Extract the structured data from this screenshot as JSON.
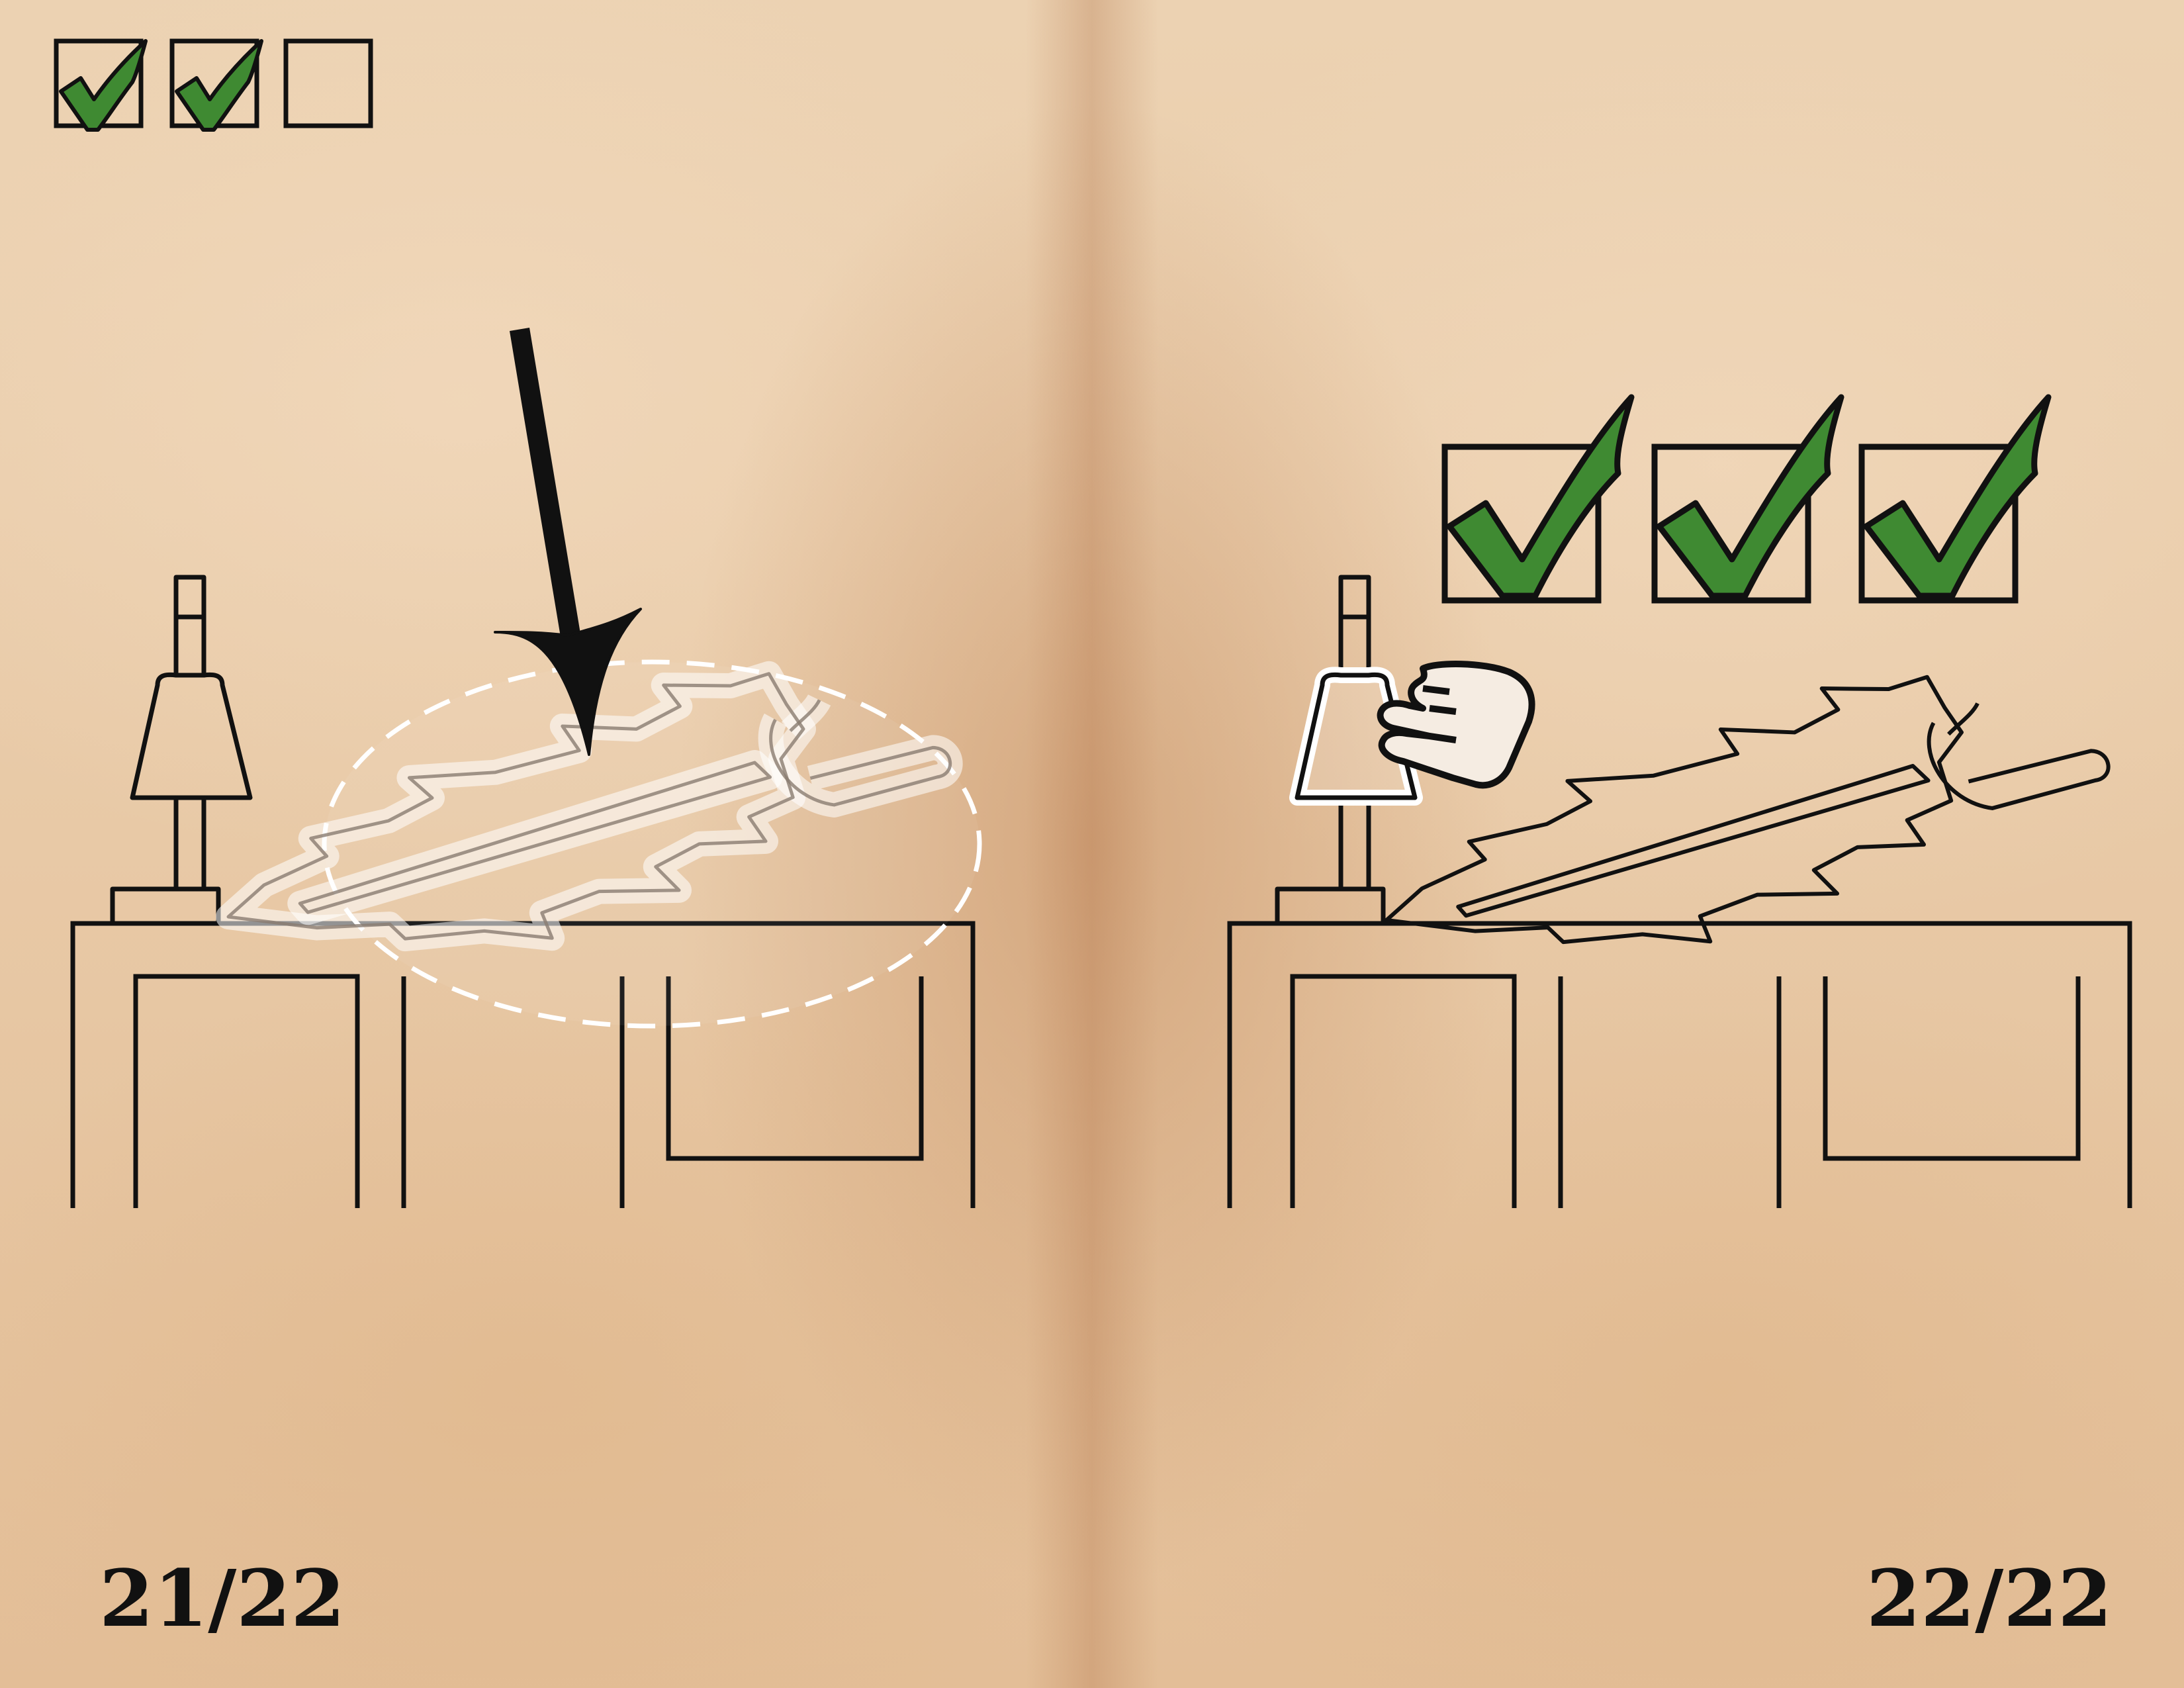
{
  "pages": {
    "left": {
      "page_number": "21/22",
      "progress": {
        "checked": 2,
        "total": 3
      }
    },
    "right": {
      "page_number": "22/22",
      "progress": {
        "checked": 3,
        "total": 3
      }
    }
  },
  "icons": {
    "check": "check-icon",
    "arrow": "down-arrow-icon",
    "hand": "pointing-hand-icon",
    "lamp": "lamp-icon",
    "sword": "sword-icon",
    "table": "table-icon"
  },
  "colors": {
    "check_green": "#3f8a32",
    "ink": "#111111",
    "highlight": "#ffffff",
    "paper": "#e8c9a6"
  }
}
